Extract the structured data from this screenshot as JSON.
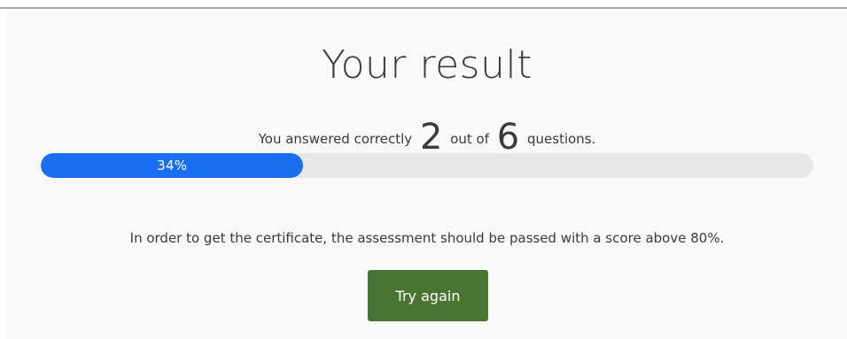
{
  "result": {
    "title": "Your result",
    "summary_prefix": "You answered correctly",
    "correct_count": "2",
    "summary_middle": "out of",
    "total_count": "6",
    "summary_suffix": "questions.",
    "progress": {
      "percent": 34,
      "label": "34%",
      "fill_color": "#1a6ef0",
      "track_color": "#e8e8ea"
    },
    "requirement_text": "In order to get the certificate, the assessment should be passed with a score above 80%.",
    "try_again_label": "Try again",
    "button_color": "#4a7431"
  }
}
